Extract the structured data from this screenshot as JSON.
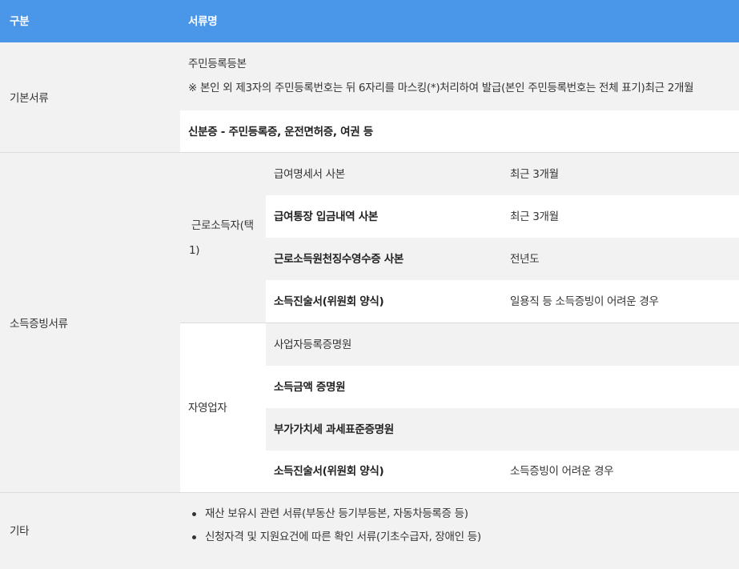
{
  "header": {
    "col_category": "구분",
    "col_docs": "서류명"
  },
  "basic": {
    "category": "기본서류",
    "resident_title": "주민등록등본",
    "resident_note": "※ 본인 외 제3자의 주민등록번호는 뒤 6자리를 마스킹(*)처리하여 발급(본인 주민등록번호는 전체 표기)최근 2개월",
    "id_card": "신분증 - 주민등록증, 운전면허증, 여권 등"
  },
  "income": {
    "category": "소득증빙서류",
    "worker": {
      "label_line1": "근로소득자(택",
      "label_line2": "1)",
      "rows": [
        {
          "doc": "급여명세서 사본",
          "note": "최근 3개월"
        },
        {
          "doc": "급여통장 입금내역 사본",
          "note": "최근 3개월"
        },
        {
          "doc": "근로소득원천징수영수증 사본",
          "note": "전년도"
        },
        {
          "doc": "소득진술서(위원회 양식)",
          "note": "일용직 등 소득증빙이 어려운 경우"
        }
      ]
    },
    "self_employed": {
      "label": "자영업자",
      "rows": [
        {
          "doc": "사업자등록증명원",
          "note": ""
        },
        {
          "doc": "소득금액 증명원",
          "note": ""
        },
        {
          "doc": "부가가치세 과세표준증명원",
          "note": ""
        },
        {
          "doc": "소득진술서(위원회 양식)",
          "note": "소득증빙이 어려운 경우"
        }
      ]
    }
  },
  "other": {
    "category": "기타",
    "items": [
      "재산 보유시 관련 서류(부동산 등기부등본, 자동차등록증 등)",
      "신청자격 및 지원요건에 따른 확인 서류(기초수급자, 장애인 등)"
    ]
  }
}
